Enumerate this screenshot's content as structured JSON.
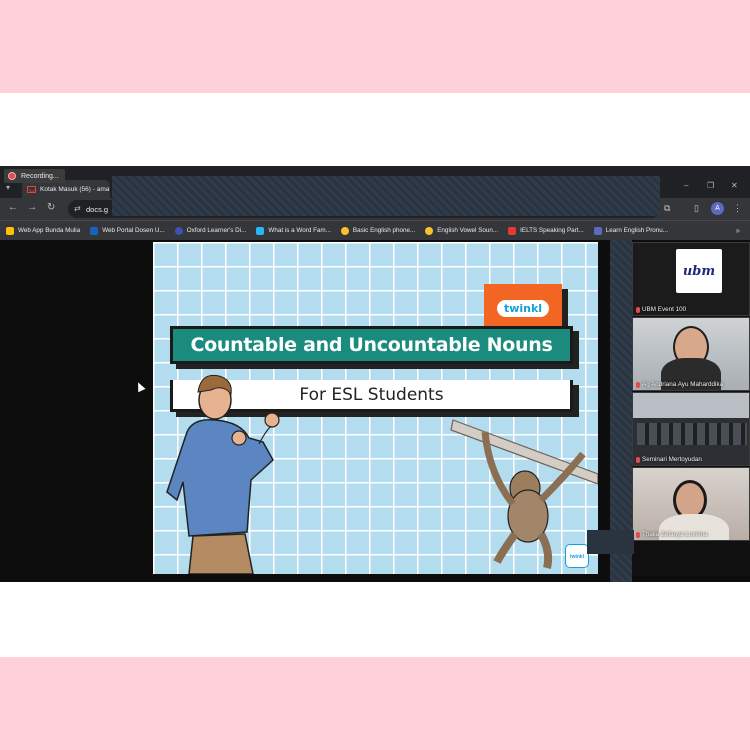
{
  "recording": {
    "label": "Recording..."
  },
  "browser": {
    "tab_title": "Kotak Masuk (56) - ama",
    "url": "docs.g",
    "avatar_letter": "A"
  },
  "bookmarks": [
    {
      "label": "Web App Bunda Mulia",
      "color": "#ffc107"
    },
    {
      "label": "Web Portal Dosen U...",
      "color": "#1565c0"
    },
    {
      "label": "Oxford Learner's Di...",
      "color": "#3f51b5"
    },
    {
      "label": "What is a Word Fam...",
      "color": "#29b6f6"
    },
    {
      "label": "Basic English phone...",
      "color": "#fbc02d"
    },
    {
      "label": "English Vowel Soun...",
      "color": "#fbc02d"
    },
    {
      "label": "IELTS Speaking Part...",
      "color": "#e53935"
    },
    {
      "label": "Learn English Pronu...",
      "color": "#5c6bc0"
    }
  ],
  "slide": {
    "brand": "twinkl",
    "title": "Countable and Uncountable Nouns",
    "subtitle": "For ESL Students",
    "corner_badge": "twinkl"
  },
  "participants": [
    {
      "name": "UBM Event 100",
      "logo_text": "ubm"
    },
    {
      "name": "Ag Andriana Ayu Maharddika"
    },
    {
      "name": "Seminari Mertoyudan"
    },
    {
      "name": "Thalia Zefanya Loveina"
    }
  ]
}
